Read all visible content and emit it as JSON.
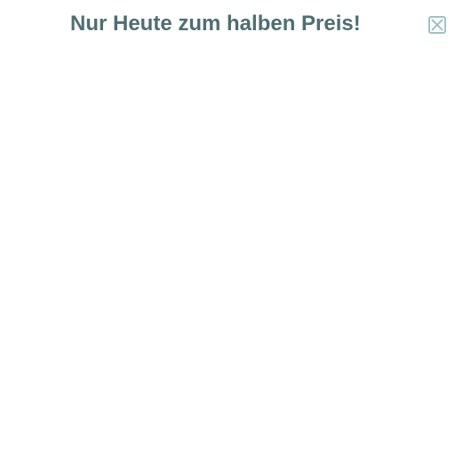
{
  "popup": {
    "headline": "Nur Heute zum halben Preis!",
    "close_icon": "close-x-box-icon"
  },
  "colors": {
    "headline": "#4e6e72",
    "close_icon": "#9ec3c6",
    "background": "#ffffff"
  }
}
